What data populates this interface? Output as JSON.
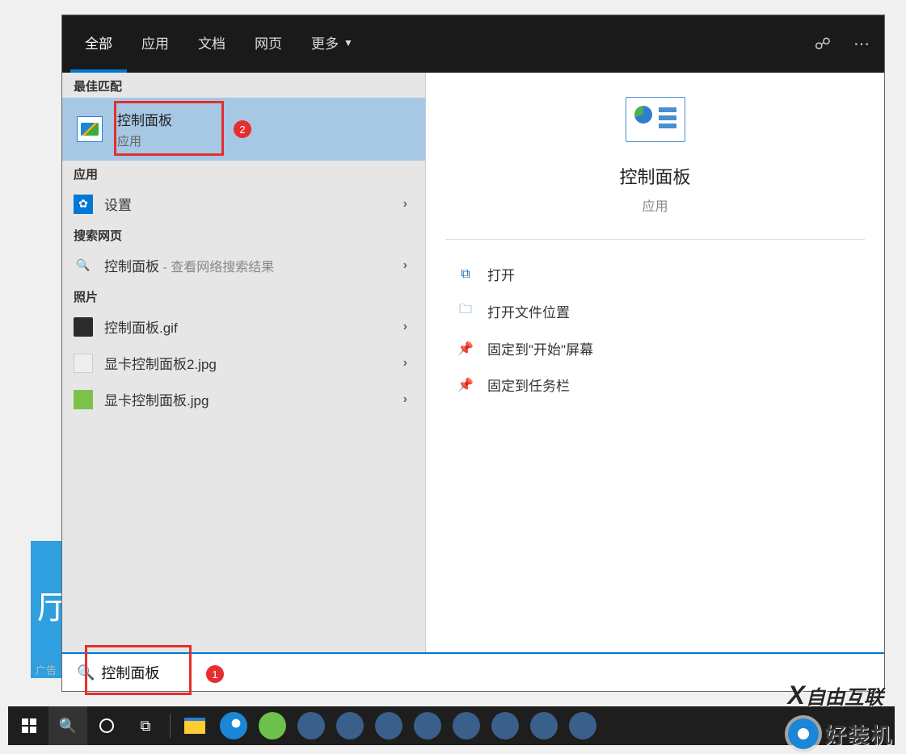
{
  "menubar": {
    "tabs": [
      "全部",
      "应用",
      "文档",
      "网页",
      "更多"
    ]
  },
  "left": {
    "best_header": "最佳匹配",
    "best": {
      "title": "控制面板",
      "sub": "应用"
    },
    "apps_header": "应用",
    "app_settings": "设置",
    "web_header": "搜索网页",
    "web_item": "控制面板",
    "web_suffix": " - 查看网络搜索结果",
    "photos_header": "照片",
    "photo1": "控制面板.gif",
    "photo2": "显卡控制面板2.jpg",
    "photo3": "显卡控制面板.jpg"
  },
  "preview": {
    "title": "控制面板",
    "sub": "应用",
    "actions": {
      "open": "打开",
      "open_location": "打开文件位置",
      "pin_start": "固定到\"开始\"屏幕",
      "pin_taskbar": "固定到任务栏"
    }
  },
  "search": {
    "value": "控制面板"
  },
  "badges": {
    "b1": "1",
    "b2": "2"
  },
  "watermarks": {
    "w1": "自由互联",
    "w2": "好装机"
  },
  "bg": {
    "tile_char": "厅",
    "ad": "广告"
  }
}
